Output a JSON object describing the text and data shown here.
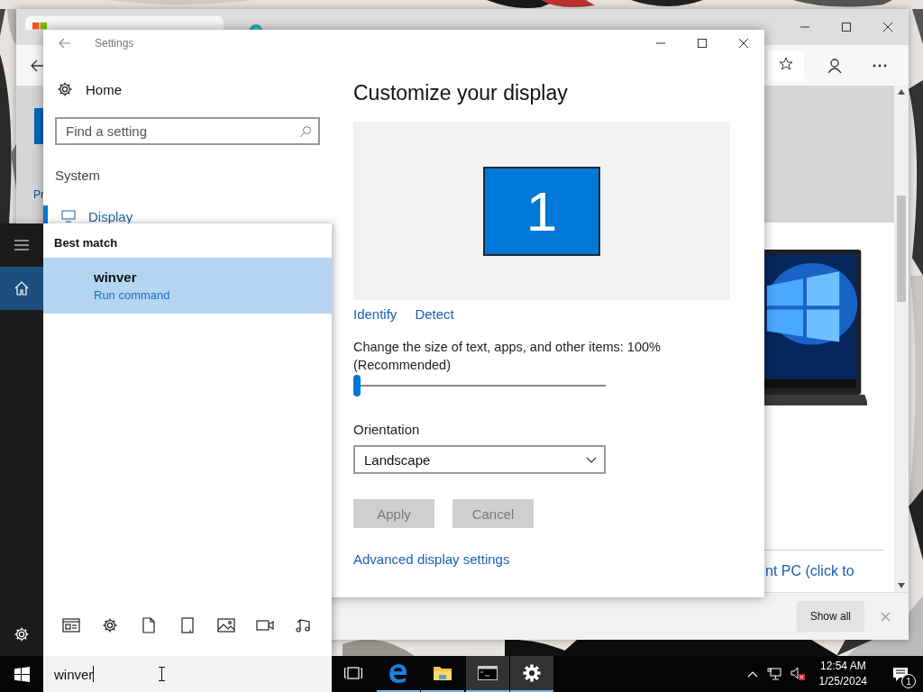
{
  "browser": {
    "tabs": [
      {
        "kind": "microsoft",
        "selected": true
      },
      {
        "kind": "edge",
        "selected": false
      }
    ],
    "page": {
      "link_fragment": "Pr",
      "caption_fragment": "nt PC (click to"
    },
    "downloads_bar": {
      "button": "Show all"
    }
  },
  "settings": {
    "window": {
      "title": "Settings"
    },
    "home": "Home",
    "search": {
      "placeholder": "Find a setting"
    },
    "section": "System",
    "nav": [
      {
        "label": "Display",
        "selected": true
      }
    ],
    "heading": "Customize your display",
    "monitor_number": "1",
    "links": [
      "Identify",
      "Detect"
    ],
    "scale_label": "Change the size of text, apps, and other items: 100% (Recommended)",
    "scale_slider": {
      "level": 0
    },
    "orientation": {
      "label": "Orientation",
      "value": "Landscape"
    },
    "buttons": [
      {
        "label": "Apply",
        "disabled": true
      },
      {
        "label": "Cancel",
        "disabled": true
      }
    ],
    "advanced_link": "Advanced display settings"
  },
  "start_menu": {
    "rail": [
      {
        "kind": "menu",
        "selected": false
      },
      {
        "kind": "home",
        "selected": true
      }
    ],
    "rail_bottom": [
      {
        "kind": "settings",
        "selected": false
      }
    ],
    "heading": "Best match",
    "results": [
      {
        "title": "winver",
        "subtitle": "Run command",
        "selected": true
      }
    ],
    "filters": [
      {
        "kind": "apps"
      },
      {
        "kind": "settings"
      },
      {
        "kind": "documents"
      },
      {
        "kind": "folders"
      },
      {
        "kind": "photos"
      },
      {
        "kind": "videos"
      },
      {
        "kind": "music"
      }
    ],
    "search": {
      "value": "winver"
    }
  },
  "taskbar": {
    "apps": [
      {
        "kind": "task_view",
        "running": false,
        "highlighted": false
      },
      {
        "kind": "edge",
        "running": true,
        "highlighted": false
      },
      {
        "kind": "folder",
        "running": true,
        "highlighted": false
      },
      {
        "kind": "cmd",
        "running": true,
        "highlighted": true
      },
      {
        "kind": "settings",
        "running": true,
        "highlighted": true
      }
    ],
    "time": "12:54 AM",
    "date": "1/25/2024",
    "notifications": "1"
  }
}
